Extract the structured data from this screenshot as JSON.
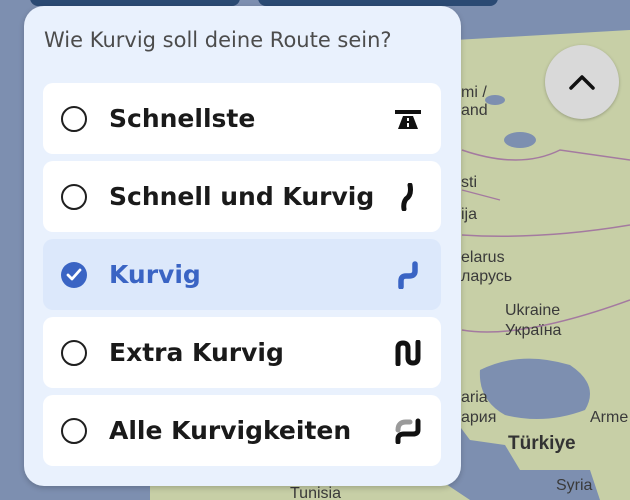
{
  "map": {
    "labels": {
      "latvia": "mi /",
      "latvia_2": "and",
      "estonia_frag": "sti",
      "lithuania_frag": "ija",
      "belarus_en": "elarus",
      "belarus_ru": "ларусь",
      "ukraine_en": "Ukraine",
      "ukraine_uk": "Україна",
      "romania_frag": "aria",
      "romania_frag2": "ария",
      "turkey": "Türkiye",
      "armenia_frag": "Arme",
      "syria": "Syria",
      "tunisia": "Tunisia"
    },
    "colors": {
      "water": "#7d8fb0",
      "land": "#c7cfa6",
      "land_dark": "#b7bf94"
    }
  },
  "route_panel": {
    "title": "Wie Kurvig soll deine Route sein?",
    "options": [
      {
        "label": "Schnellste",
        "icon": "highway-icon",
        "selected": false
      },
      {
        "label": "Schnell und Kurvig",
        "icon": "slight-curve-icon",
        "selected": false
      },
      {
        "label": "Kurvig",
        "icon": "curvy-road-icon",
        "selected": true
      },
      {
        "label": "Extra Kurvig",
        "icon": "extra-curvy-icon",
        "selected": false
      },
      {
        "label": "Alle Kurvigkeiten",
        "icon": "all-curves-icon",
        "selected": false
      }
    ],
    "colors": {
      "panel_bg": "#e9f1fd",
      "selected_bg": "#dce8fb",
      "accent": "#3a64c4"
    }
  },
  "collapse_button": {
    "icon": "chevron-up-icon"
  }
}
